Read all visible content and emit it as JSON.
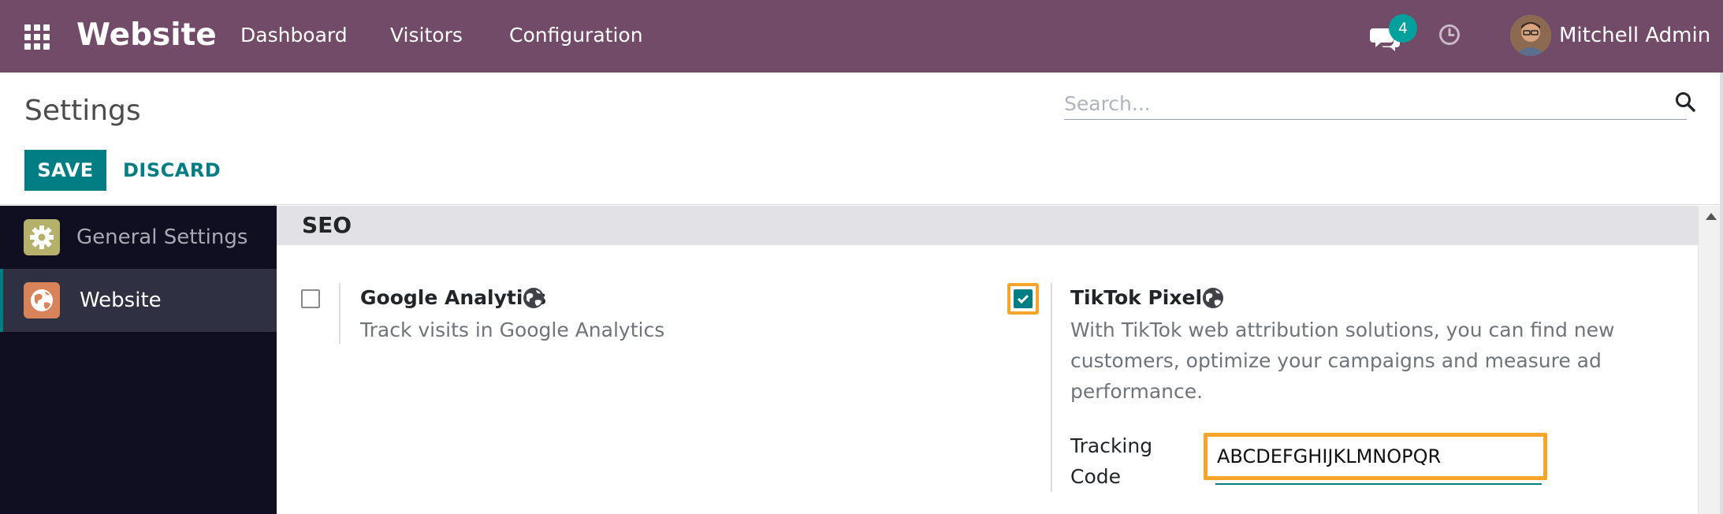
{
  "navbar": {
    "app_title": "Website",
    "menu": [
      {
        "label": "Dashboard"
      },
      {
        "label": "Visitors"
      },
      {
        "label": "Configuration"
      }
    ],
    "messages_badge": "4",
    "user_name": "Mitchell Admin",
    "background_color": "#714b67"
  },
  "control_panel": {
    "page_title": "Settings",
    "search_placeholder": "Search...",
    "save_label": "SAVE",
    "discard_label": "DISCARD",
    "accent_color": "#017e84"
  },
  "sidebar": {
    "items": [
      {
        "label": "General Settings",
        "icon": "gear-icon",
        "active": false
      },
      {
        "label": "Website",
        "icon": "globe-icon",
        "active": true
      }
    ]
  },
  "main": {
    "section_title": "SEO",
    "settings": [
      {
        "title": "Google Analytics",
        "description": "Track visits in Google Analytics",
        "checked": false,
        "icon": "globe-icon"
      },
      {
        "title": "TikTok Pixel",
        "description_lines": [
          "With TikTok web attribution solutions, you can find new",
          "customers, optimize your campaigns and measure ad",
          "performance."
        ],
        "checked": true,
        "icon": "globe-icon",
        "field_label_lines": [
          "Tracking",
          "Code"
        ],
        "field_value": "ABCDEFGHIJKLMNOPQR"
      }
    ],
    "highlight_color": "#f6a42a"
  }
}
